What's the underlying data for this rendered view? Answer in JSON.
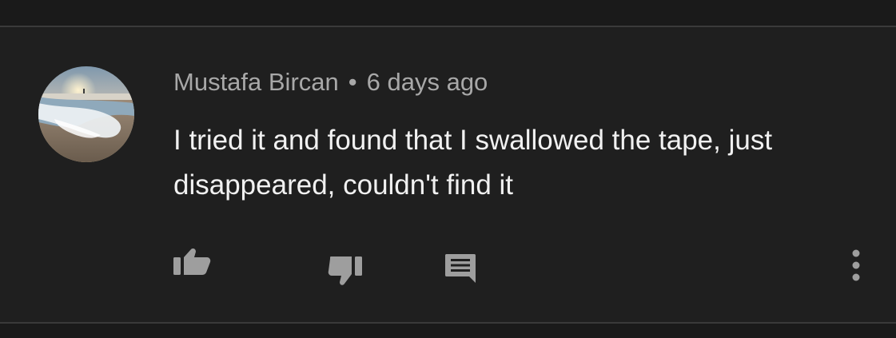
{
  "comment": {
    "author": "Mustafa Bircan",
    "separator": "•",
    "timestamp": "6 days ago",
    "text": "I tried it and found that I swallowed the tape, just disappeared, couldn't find it"
  },
  "actions": {
    "like_icon": "thumbs-up-icon",
    "dislike_icon": "thumbs-down-icon",
    "reply_icon": "comment-icon",
    "more_icon": "more-vertical-icon"
  },
  "colors": {
    "background": "#1f1f1f",
    "meta_text": "#a8a8a8",
    "body_text": "#f1f1f1",
    "icon": "#9e9e9e"
  }
}
